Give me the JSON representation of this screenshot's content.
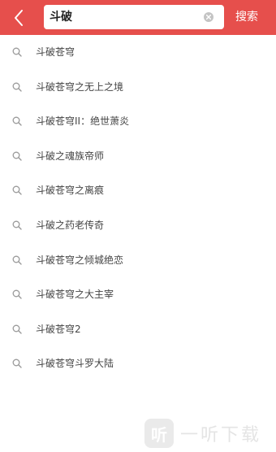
{
  "colors": {
    "header_bg": "#e64f4c",
    "list_text": "#444444",
    "icon_gray": "#9a9a9a"
  },
  "header": {
    "back_icon": "chevron-left-icon",
    "search_value": "斗破",
    "clear_icon": "clear-circle-icon",
    "search_button_label": "搜索"
  },
  "suggestions": [
    {
      "icon": "search-icon",
      "label": "斗破苍穹"
    },
    {
      "icon": "search-icon",
      "label": "斗破苍穹之无上之境"
    },
    {
      "icon": "search-icon",
      "label": "斗破苍穹II：绝世萧炎"
    },
    {
      "icon": "search-icon",
      "label": "斗破之魂族帝师"
    },
    {
      "icon": "search-icon",
      "label": "斗破苍穹之离痕"
    },
    {
      "icon": "search-icon",
      "label": "斗破之药老传奇"
    },
    {
      "icon": "search-icon",
      "label": "斗破苍穹之倾城绝恋"
    },
    {
      "icon": "search-icon",
      "label": "斗破苍穹之大主宰"
    },
    {
      "icon": "search-icon",
      "label": "斗破苍穹2"
    },
    {
      "icon": "search-icon",
      "label": "斗破苍穹斗罗大陆"
    }
  ],
  "watermark": {
    "logo_glyph": "听",
    "text": "一听下载"
  }
}
